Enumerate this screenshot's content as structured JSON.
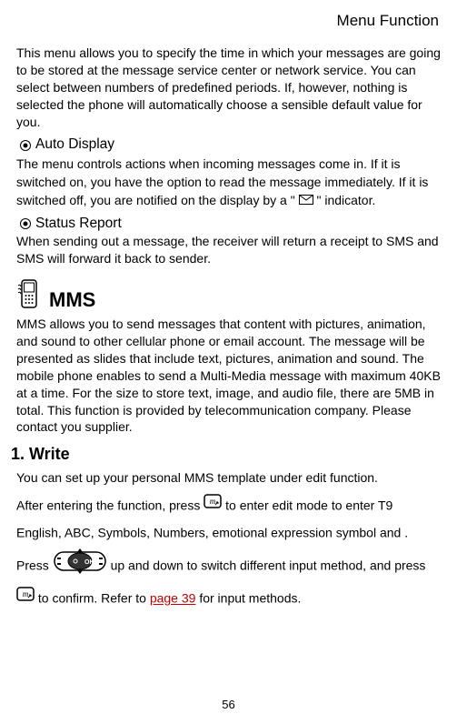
{
  "header": "Menu Function",
  "intro": "This menu allows you to specify the time in which your messages are going to be stored at the message service center or network service. You can select between numbers of predefined periods. If, however, nothing is selected the phone will automatically choose a sensible default value for you.",
  "auto_display": {
    "title": "Auto Display",
    "body_a": "The menu controls actions when incoming messages come in. If it is switched on, you have the option to read the message immediately. If it is switched off, you are notified on the display by a \"",
    "body_b": "\" indicator."
  },
  "status_report": {
    "title": "Status Report",
    "body": "When sending out a message, the receiver will return a receipt to SMS and SMS will forward it back to sender."
  },
  "mms": {
    "title": "MMS",
    "body": "MMS allows you to send messages that content with pictures, animation, and sound to other cellular phone or email account. The message will be presented as slides that include text, pictures, animation and sound. The mobile phone enables to send a Multi-Media message with maximum 40KB at a time.    For the size to store text, image, and audio file, there are 5MB in total. This function is provided by telecommunication company. Please contact you supplier."
  },
  "write": {
    "title": "1. Write",
    "p1": "You can set up your personal MMS template under edit function.",
    "p2a": "After entering the function, press ",
    "p2b": " to enter edit mode to enter T9 English, ABC, Symbols, Numbers, emotional expression symbol and .    Press ",
    "p2c": " up and down to switch different input method, and press ",
    "p2d": " to confirm.    Refer to ",
    "link": "page 39",
    "p2e": " for input methods."
  },
  "page_number": "56"
}
